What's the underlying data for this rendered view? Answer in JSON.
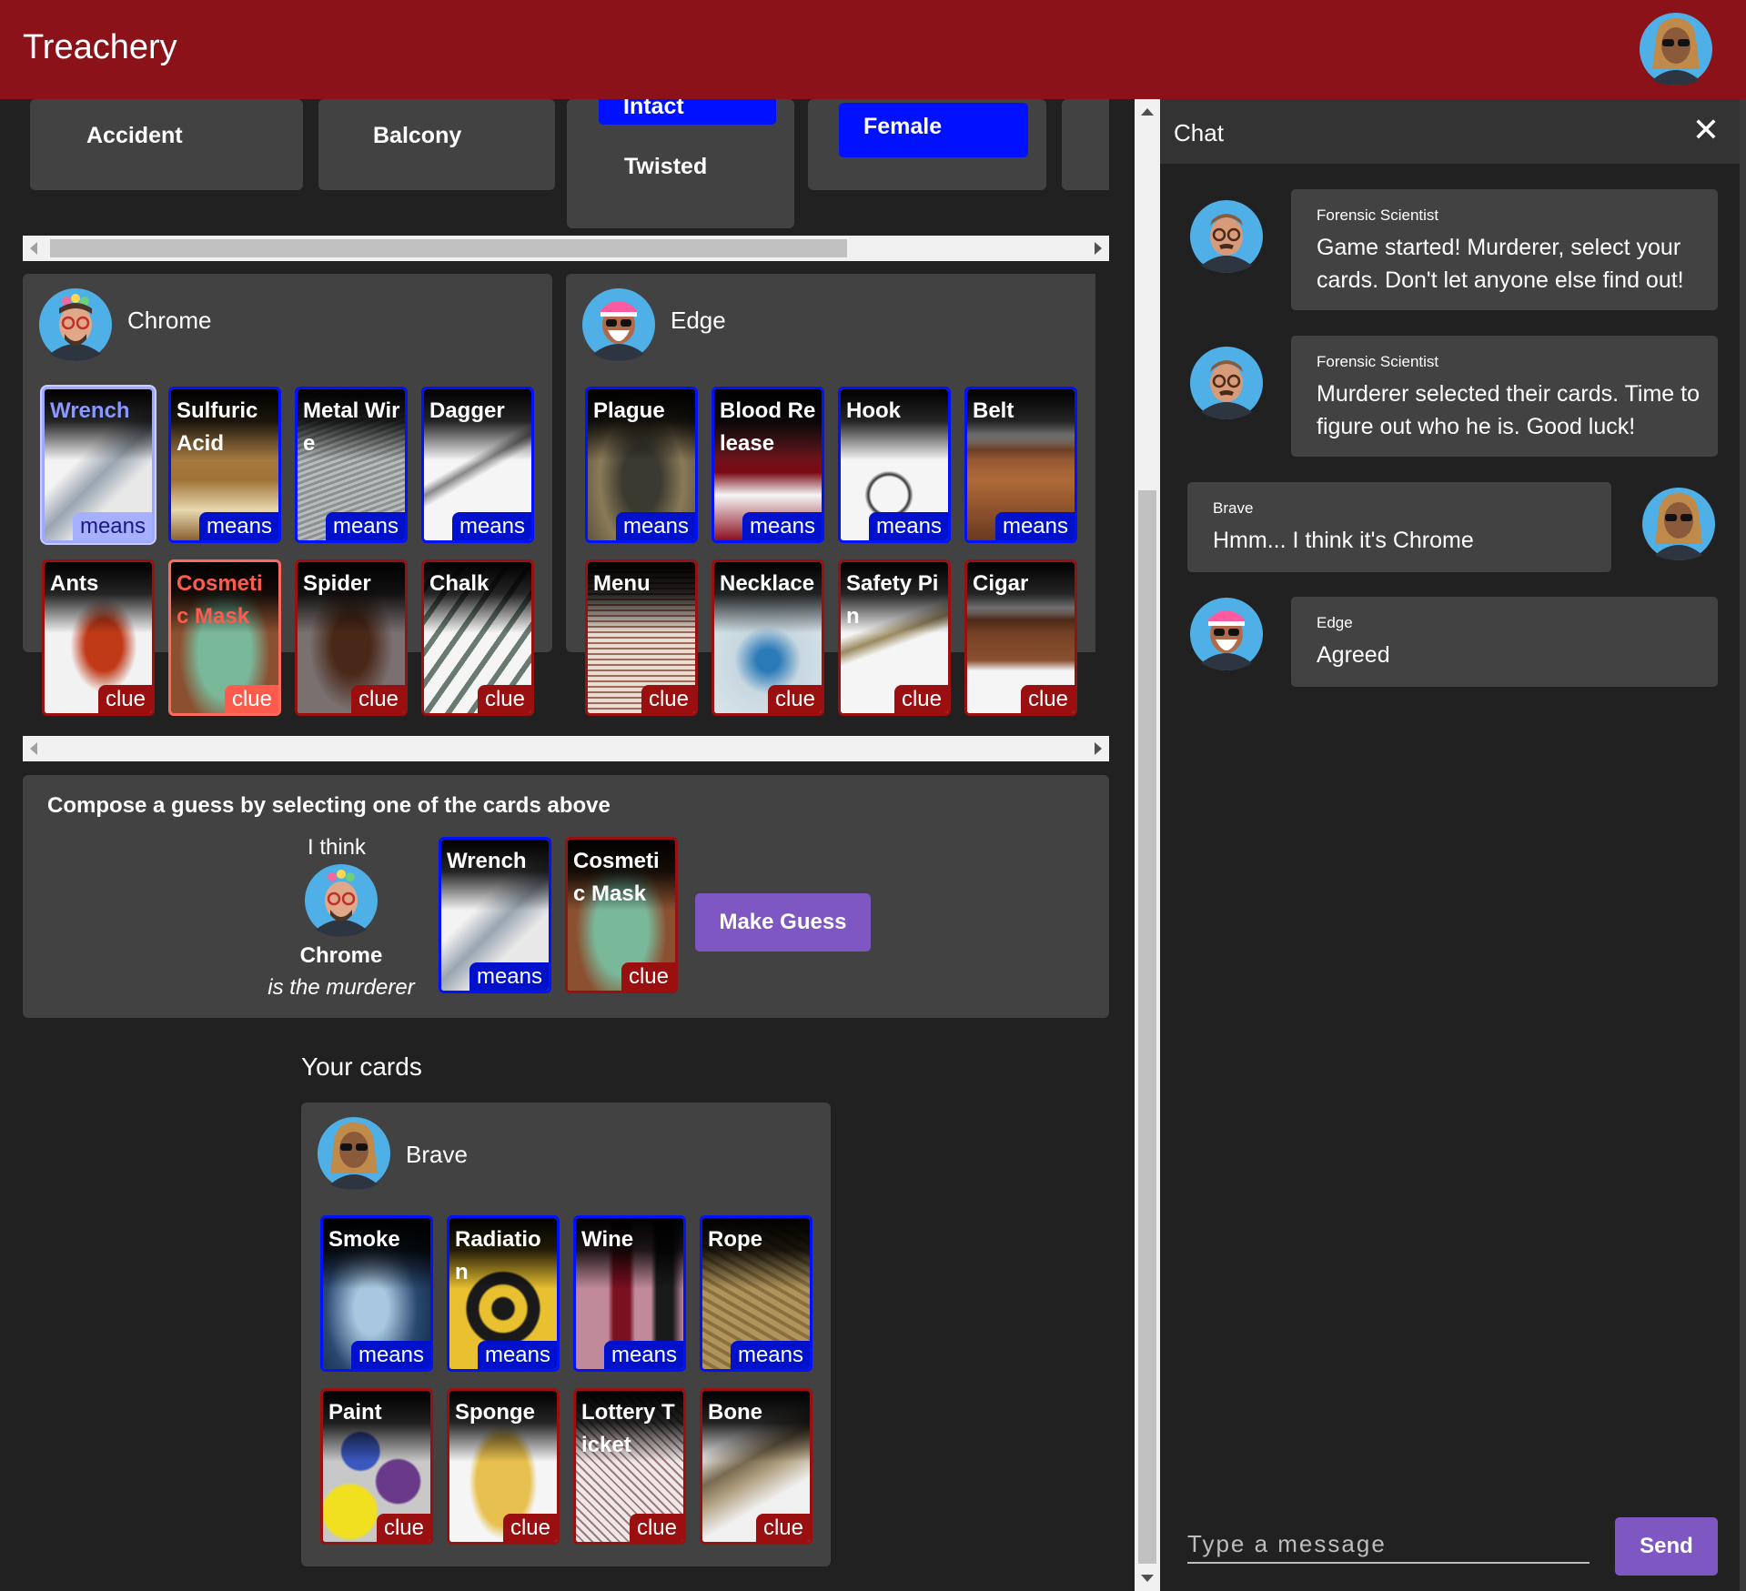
{
  "app": {
    "title": "Treachery"
  },
  "top_row": {
    "items": [
      "Accident",
      "Balcony",
      "Intact",
      "Twisted",
      "Female"
    ]
  },
  "players": [
    {
      "name": "Chrome",
      "means": [
        "Wrench",
        "Sulfuric Acid",
        "Metal Wire",
        "Dagger"
      ],
      "clues": [
        "Ants",
        "Cosmetic Mask",
        "Spider",
        "Chalk"
      ]
    },
    {
      "name": "Edge",
      "means": [
        "Plague",
        "Blood Release",
        "Hook",
        "Belt"
      ],
      "clues": [
        "Menu",
        "Necklace",
        "Safety Pin",
        "Cigar"
      ]
    }
  ],
  "tags": {
    "means": "means",
    "clue": "clue"
  },
  "guess": {
    "heading": "Compose a guess by selecting one of the cards above",
    "i_think": "I think",
    "suspect": "Chrome",
    "is_murderer": "is the murderer",
    "means_card": "Wrench",
    "clue_card": "Cosmetic Mask",
    "button": "Make Guess"
  },
  "your_cards": {
    "title": "Your cards",
    "player": "Brave",
    "means": [
      "Smoke",
      "Radiation",
      "Wine",
      "Rope"
    ],
    "clues": [
      "Paint",
      "Sponge",
      "Lottery Ticket",
      "Bone"
    ]
  },
  "chat": {
    "title": "Chat",
    "messages": [
      {
        "sender": "Forensic Scientist",
        "text": "Game started! Murderer, select your cards. Don't let anyone else find out!"
      },
      {
        "sender": "Forensic Scientist",
        "text": "Murderer selected their cards. Time to figure out who he is. Good luck!"
      },
      {
        "sender": "Brave",
        "text": "Hmm... I think it's Chrome"
      },
      {
        "sender": "Edge",
        "text": "Agreed"
      }
    ],
    "input_placeholder": "Type a message",
    "send": "Send"
  },
  "colors": {
    "appbar": "#8b1218",
    "means": "#0011ff",
    "clue": "#9a1010",
    "button": "#7e57c2",
    "panel": "#424242",
    "background": "#212121"
  }
}
